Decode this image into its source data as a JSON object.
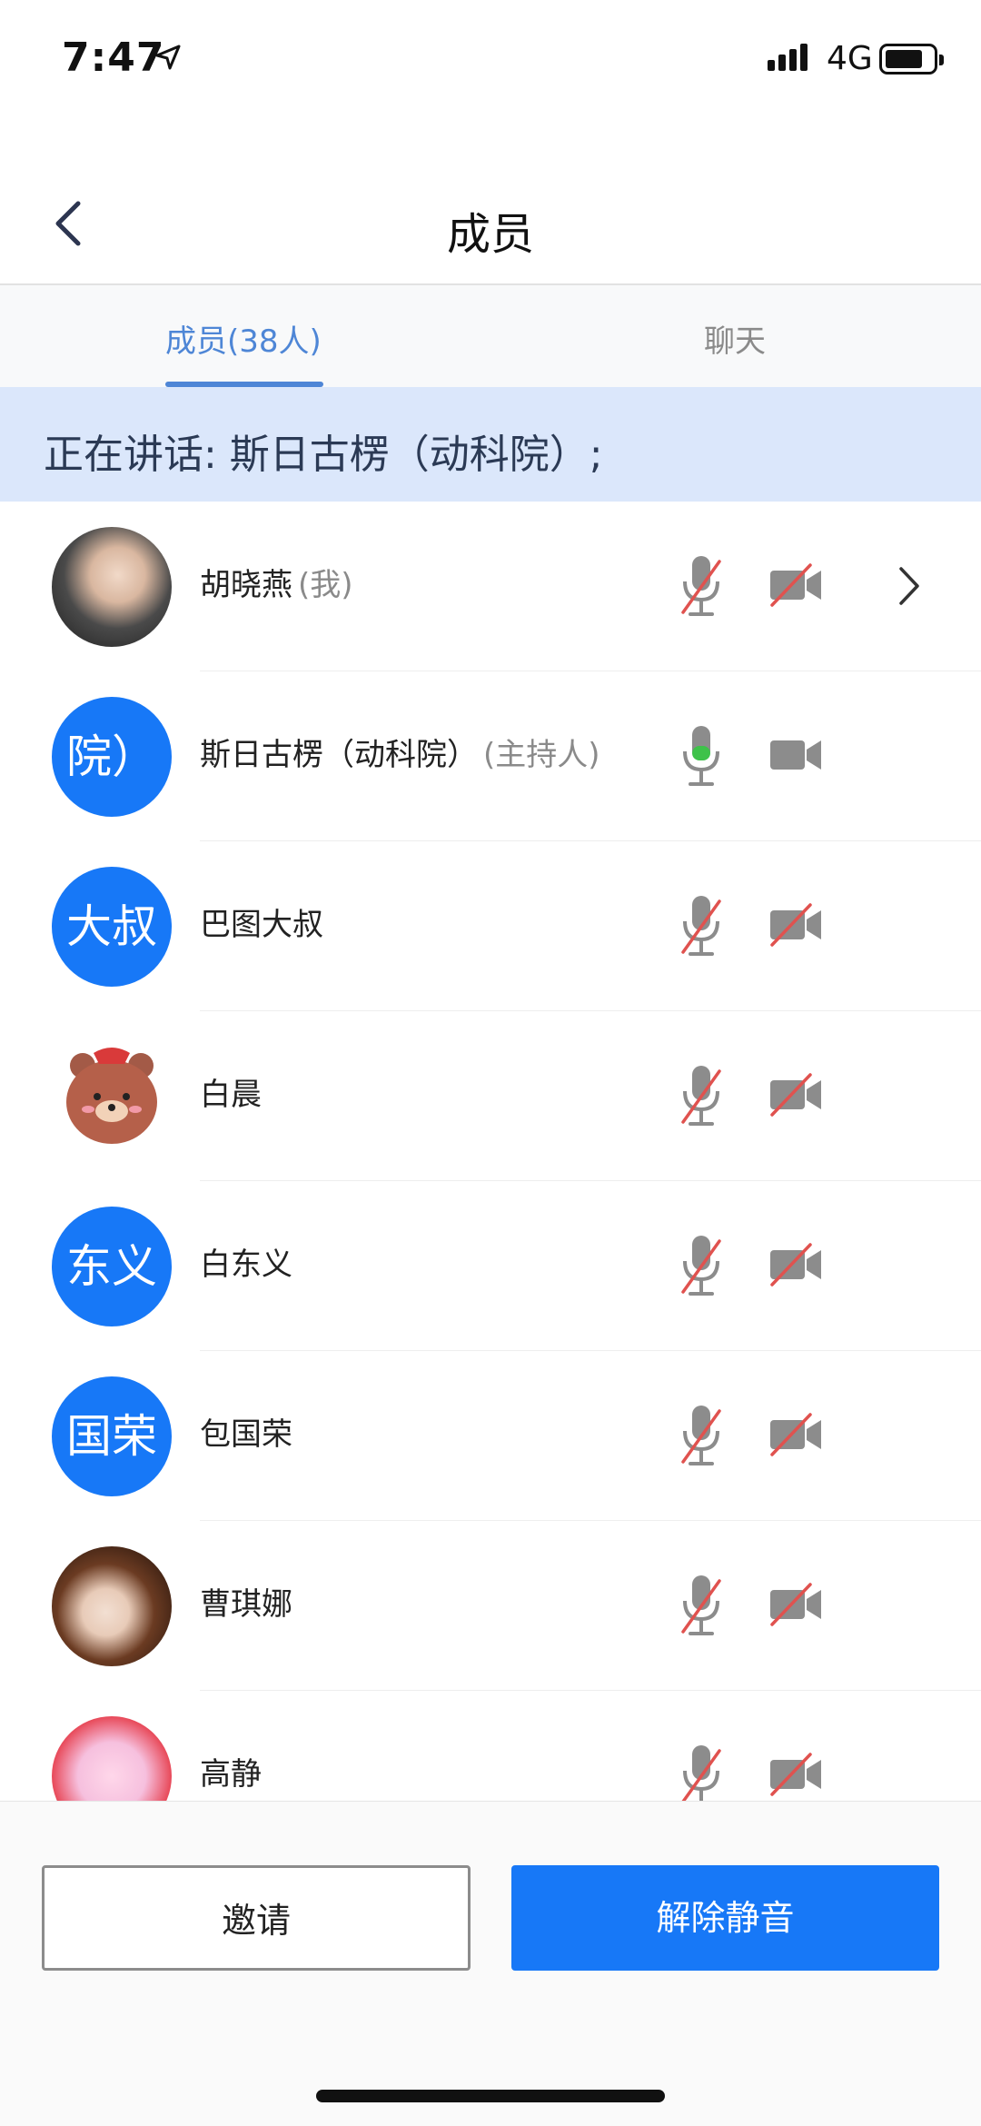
{
  "status_bar": {
    "time": "7:47",
    "network": "4G"
  },
  "header": {
    "title": "成员"
  },
  "tabs": [
    {
      "label": "成员(38人)",
      "active": true
    },
    {
      "label": "聊天",
      "active": false
    }
  ],
  "speaking_banner": "正在讲话: 斯日古楞（动科院）;",
  "members": [
    {
      "name": "胡晓燕",
      "tag": "(我)",
      "avatar_type": "photo",
      "avatar_text": "",
      "mic": "muted",
      "camera": "off",
      "has_chevron": true
    },
    {
      "name": "斯日古楞（动科院）",
      "tag": "(主持人)",
      "avatar_type": "initials",
      "avatar_text": "院）",
      "mic": "on",
      "camera": "on",
      "has_chevron": false
    },
    {
      "name": "巴图大叔",
      "tag": "",
      "avatar_type": "initials",
      "avatar_text": "大叔",
      "mic": "muted",
      "camera": "off",
      "has_chevron": false
    },
    {
      "name": "白晨",
      "tag": "",
      "avatar_type": "photo",
      "avatar_text": "",
      "mic": "muted",
      "camera": "off",
      "has_chevron": false
    },
    {
      "name": "白东义",
      "tag": "",
      "avatar_type": "initials",
      "avatar_text": "东义",
      "mic": "muted",
      "camera": "off",
      "has_chevron": false
    },
    {
      "name": "包国荣",
      "tag": "",
      "avatar_type": "initials",
      "avatar_text": "国荣",
      "mic": "muted",
      "camera": "off",
      "has_chevron": false
    },
    {
      "name": "曹琪娜",
      "tag": "",
      "avatar_type": "photo",
      "avatar_text": "",
      "mic": "muted",
      "camera": "off",
      "has_chevron": false
    },
    {
      "name": "高静",
      "tag": "",
      "avatar_type": "photo",
      "avatar_text": "",
      "mic": "muted",
      "camera": "off",
      "has_chevron": false
    }
  ],
  "buttons": {
    "invite": "邀请",
    "unmute": "解除静音"
  },
  "colors": {
    "accent": "#1778f7",
    "tab_active": "#4e86d6",
    "muted_slash": "#e0524f",
    "mic_on": "#3ec24a",
    "banner_bg": "#dbe7fb"
  }
}
